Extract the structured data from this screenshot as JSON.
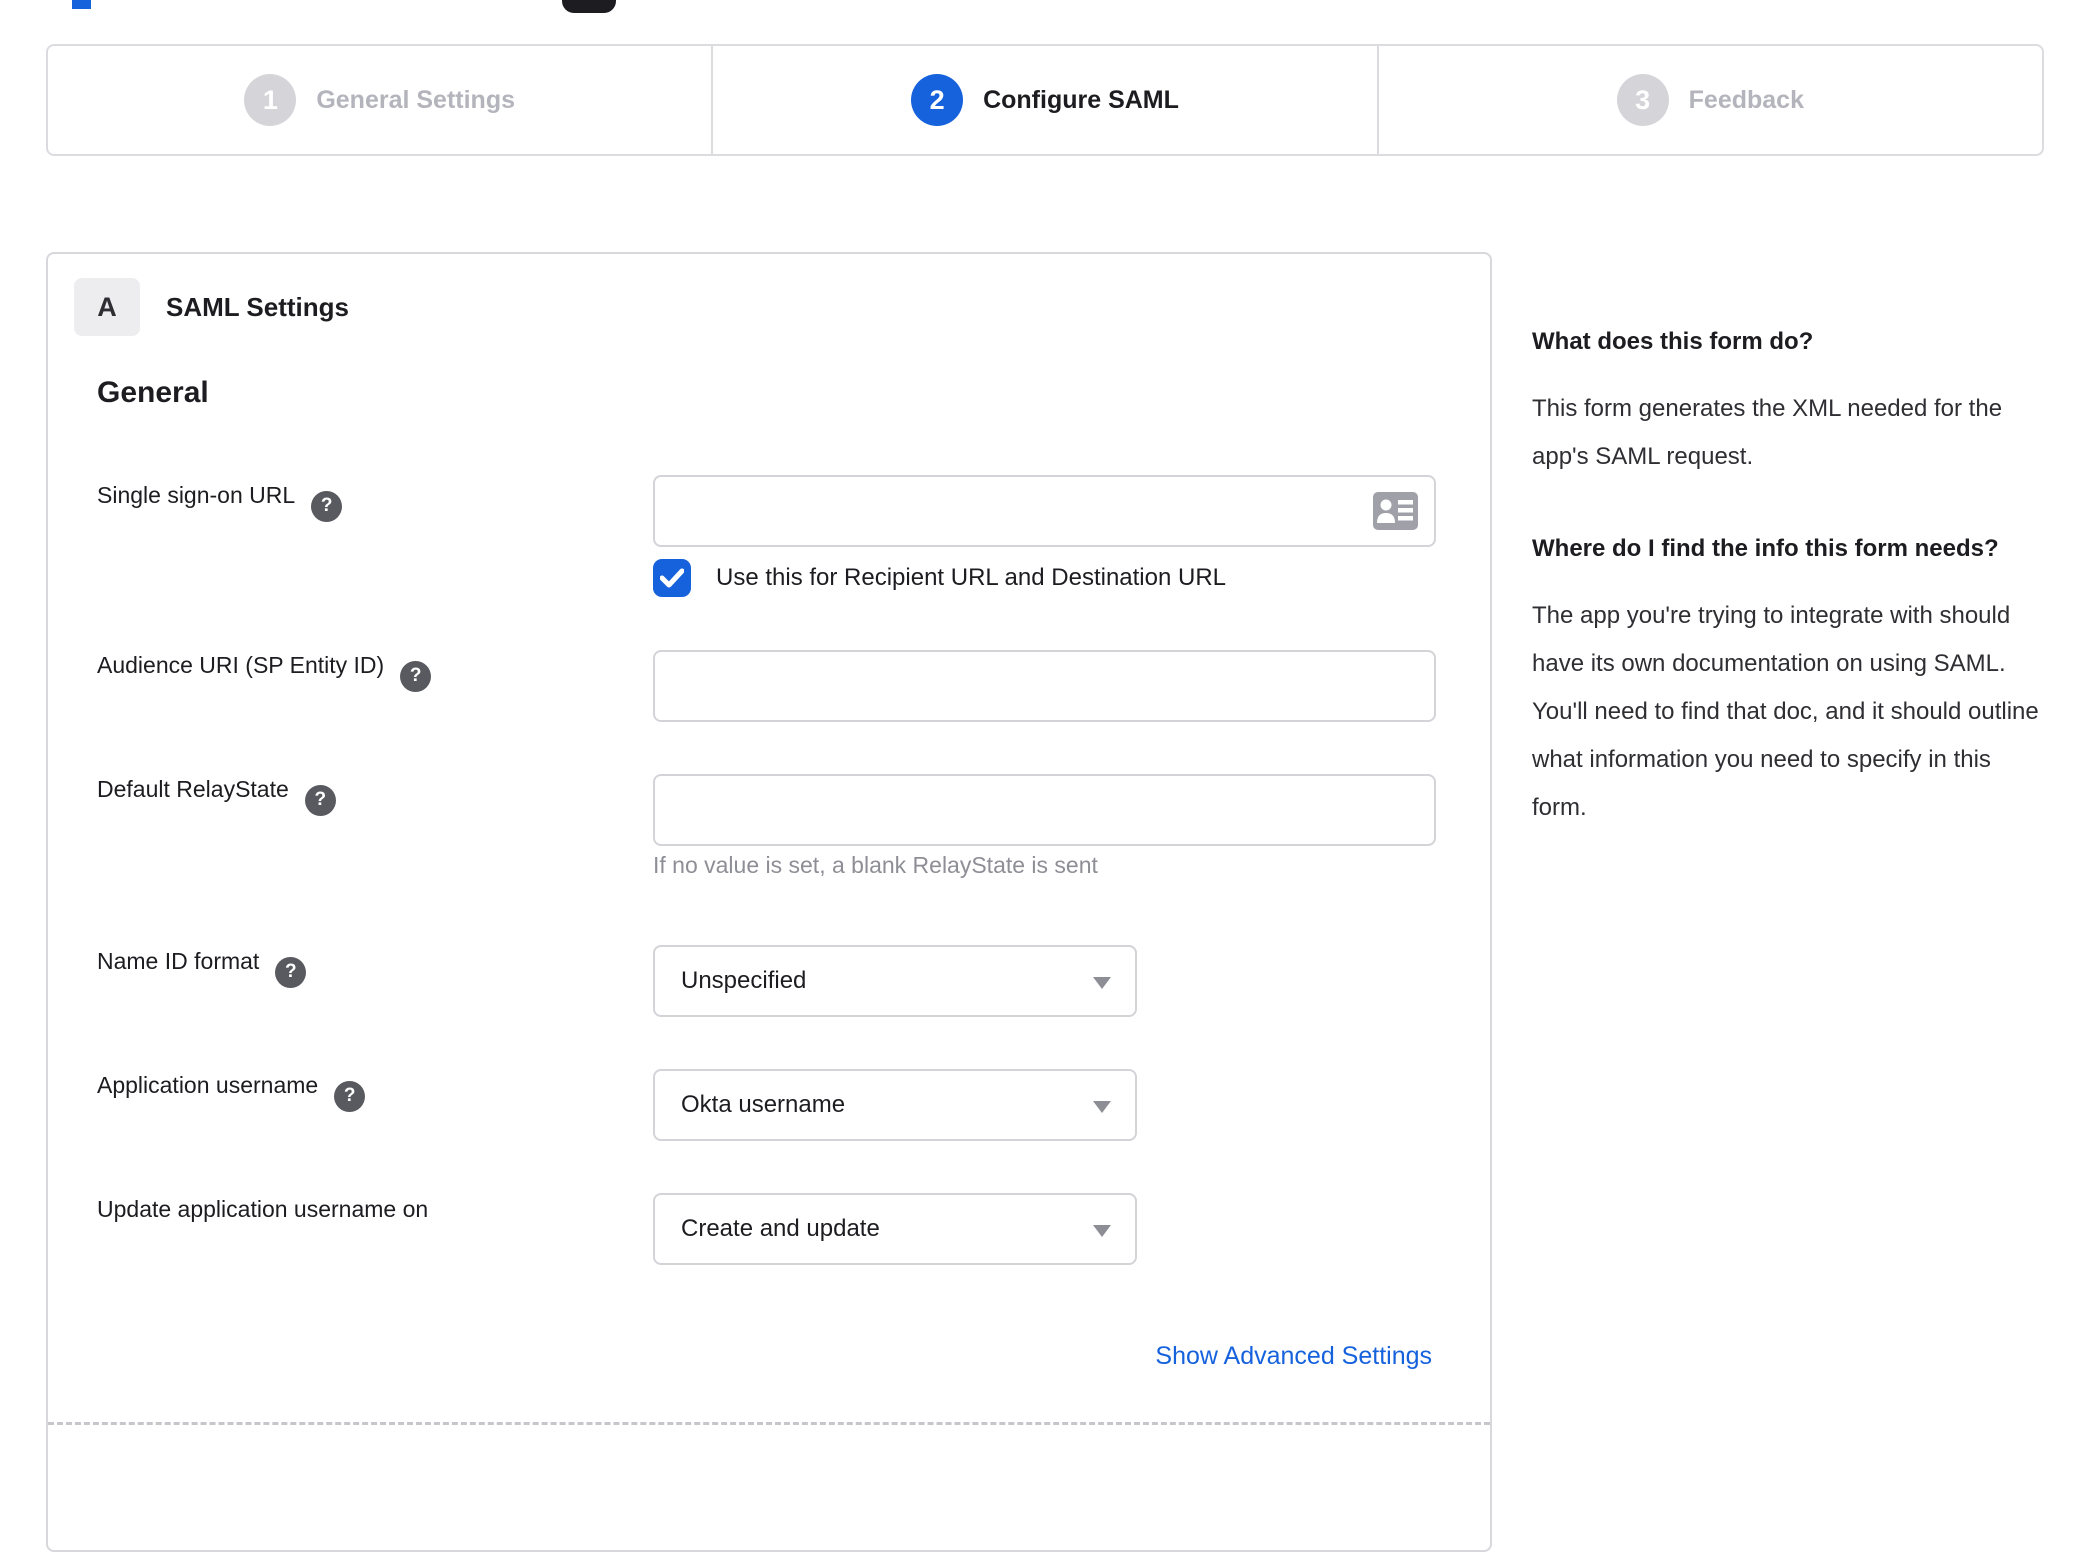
{
  "colors": {
    "accent_blue": "#1662dd",
    "inactive_gray": "#b4b4bc",
    "border_gray": "#d8d8dc",
    "hint_gray": "#8e8e96",
    "text_dark": "#1d1d21"
  },
  "icons": {
    "help_glyph": "?"
  },
  "stepper": {
    "steps": [
      {
        "number": "1",
        "label": "General Settings",
        "state": "inactive"
      },
      {
        "number": "2",
        "label": "Configure SAML",
        "state": "active"
      },
      {
        "number": "3",
        "label": "Feedback",
        "state": "inactive"
      }
    ]
  },
  "panel": {
    "section_badge": "A",
    "section_title": "SAML Settings",
    "group_heading": "General",
    "fields": {
      "sso_url": {
        "label": "Single sign-on URL",
        "value": "",
        "checkbox_label": "Use this for Recipient URL and Destination URL",
        "checkbox_checked": true
      },
      "audience_uri": {
        "label": "Audience URI (SP Entity ID)",
        "value": ""
      },
      "relay_state": {
        "label": "Default RelayState",
        "value": "",
        "hint": "If no value is set, a blank RelayState is sent"
      },
      "name_id_format": {
        "label": "Name ID format",
        "value": "Unspecified"
      },
      "app_username": {
        "label": "Application username",
        "value": "Okta username"
      },
      "update_app_username": {
        "label": "Update application username on",
        "value": "Create and update"
      }
    },
    "advanced_link": "Show Advanced Settings"
  },
  "sidebar": {
    "sections": [
      {
        "heading": "What does this form do?",
        "body": "This form generates the XML needed for the app's SAML request."
      },
      {
        "heading": "Where do I find the info this form needs?",
        "body": "The app you're trying to integrate with should have its own documentation on using SAML. You'll need to find that doc, and it should outline what information you need to specify in this form."
      }
    ]
  }
}
